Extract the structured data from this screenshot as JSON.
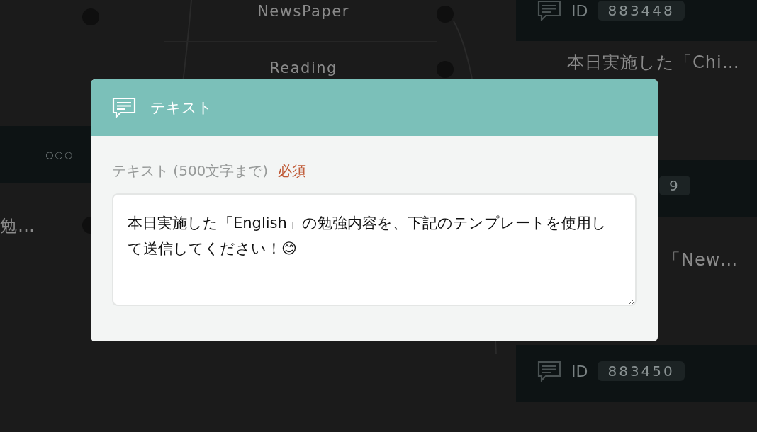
{
  "canvas": {
    "options": [
      {
        "label": "NewsPaper"
      },
      {
        "label": "Reading"
      }
    ],
    "left_card": {
      "menu": "○○○",
      "excerpt": "勉…"
    },
    "cards": [
      {
        "id_label": "ID",
        "id": "883448",
        "excerpt": "本日実施した「Chi…"
      },
      {
        "id": "9",
        "excerpt": "「New…"
      },
      {
        "id_label": "ID",
        "id": "883450"
      }
    ]
  },
  "dialog": {
    "title": "テキスト",
    "field_label": "テキスト (500文字まで)",
    "required": "必須",
    "value": "本日実施した「English」の勉強内容を、下記のテンプレートを使用して送信してください！😊"
  }
}
